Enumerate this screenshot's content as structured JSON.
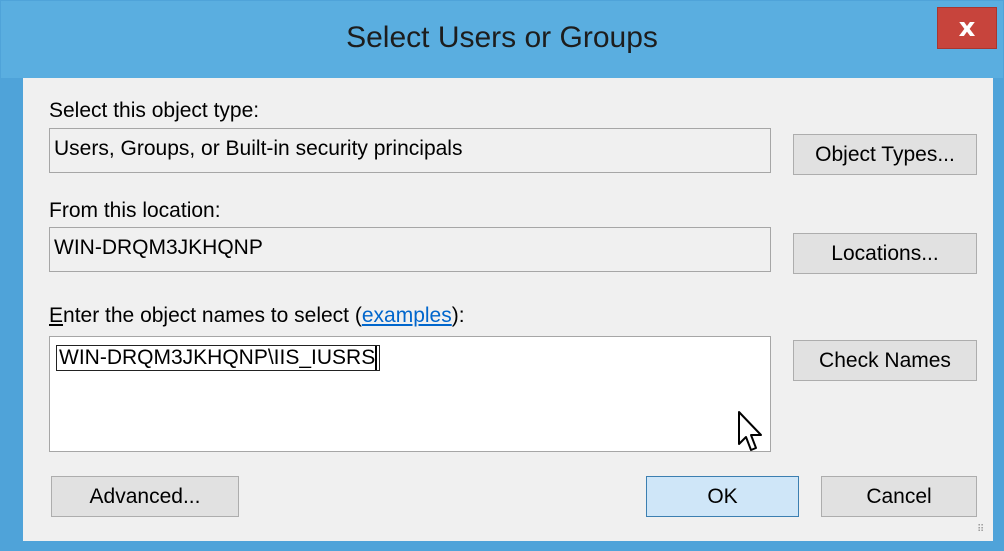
{
  "dialog": {
    "title": "Select Users or Groups",
    "close_glyph": "x"
  },
  "object_type": {
    "label": "Select this object type:",
    "value": "Users, Groups, or Built-in security principals",
    "button": "Object Types..."
  },
  "location": {
    "label": "From this location:",
    "value": "WIN-DRQM3JKHQNP",
    "button": "Locations..."
  },
  "names": {
    "label_mnemonic": "E",
    "label_rest": "nter the object names to select (",
    "link": "examples",
    "label_end": "):",
    "value": "WIN-DRQM3JKHQNP\\IIS_IUSRS",
    "button": "Check Names"
  },
  "footer": {
    "advanced": "Advanced...",
    "ok": "OK",
    "cancel": "Cancel"
  },
  "icons": {
    "close": "close-icon",
    "cursor": "mouse-pointer-icon",
    "grip": "resize-grip-icon"
  },
  "colors": {
    "titlebar": "#5aaee0",
    "close": "#c7443c",
    "dialog_bg": "#f0f0f0",
    "default_button": "#cfe6f8",
    "link": "#0066cc"
  }
}
